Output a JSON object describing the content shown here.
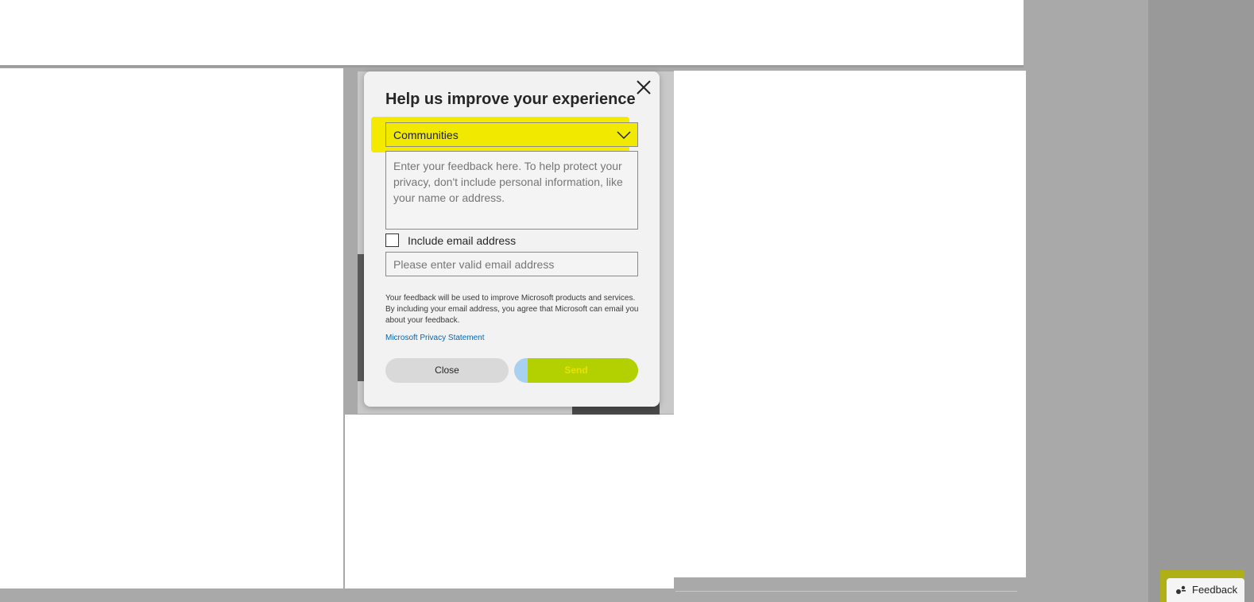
{
  "dialog": {
    "title": "Help us improve your experience",
    "category_select": {
      "selected": "Communities"
    },
    "feedback_textarea": {
      "placeholder": "Enter your feedback here. To help protect your privacy, don't include personal information, like your name or address."
    },
    "include_email_label": "Include email address",
    "email_input": {
      "placeholder": "Please enter valid email address"
    },
    "disclaimer": "Your feedback will be used to improve Microsoft products and services. By including your email address, you agree that Microsoft can email you about your feedback.",
    "privacy_link": "Microsoft Privacy Statement",
    "close_button": "Close",
    "send_button": "Send"
  },
  "feedback_button": {
    "label": "Feedback"
  },
  "colors": {
    "highlight_yellow": "#f3ea00",
    "send_highlight": "#b3d100",
    "link_blue": "#0067b8",
    "dialog_bg": "#f2f2f2"
  }
}
